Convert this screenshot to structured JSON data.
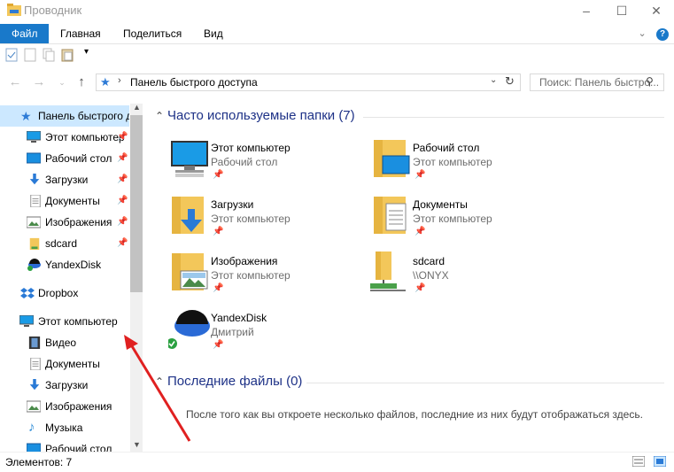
{
  "window": {
    "title": "Проводник"
  },
  "ribbon": {
    "tabs": [
      "Файл",
      "Главная",
      "Поделиться",
      "Вид"
    ]
  },
  "address": {
    "path": "Панель быстрого доступа"
  },
  "search": {
    "placeholder": "Поиск: Панель быстро..."
  },
  "sidebar": {
    "items": [
      {
        "label": "Панель быстрого д",
        "icon": "star-icon"
      },
      {
        "label": "Этот компьютер",
        "icon": "computer-icon",
        "pinned": true
      },
      {
        "label": "Рабочий стол",
        "icon": "desktop-icon",
        "pinned": true
      },
      {
        "label": "Загрузки",
        "icon": "downloads-icon",
        "pinned": true
      },
      {
        "label": "Документы",
        "icon": "documents-icon",
        "pinned": true
      },
      {
        "label": "Изображения",
        "icon": "pictures-icon",
        "pinned": true
      },
      {
        "label": "sdcard",
        "icon": "folder-icon",
        "pinned": true
      },
      {
        "label": "YandexDisk",
        "icon": "yandexdisk-icon"
      },
      {
        "label": "Dropbox",
        "icon": "dropbox-icon"
      },
      {
        "label": "Этот компьютер",
        "icon": "computer-icon"
      },
      {
        "label": "Видео",
        "icon": "video-icon"
      },
      {
        "label": "Документы",
        "icon": "documents-icon"
      },
      {
        "label": "Загрузки",
        "icon": "downloads-icon"
      },
      {
        "label": "Изображения",
        "icon": "pictures-icon"
      },
      {
        "label": "Музыка",
        "icon": "music-icon"
      },
      {
        "label": "Рабочий стол",
        "icon": "desktop-icon"
      }
    ]
  },
  "frequent": {
    "header": "Часто используемые папки (7)",
    "folders": [
      {
        "name": "Этот компьютер",
        "location": "Рабочий стол",
        "icon": "computer-icon"
      },
      {
        "name": "Рабочий стол",
        "location": "Этот компьютер",
        "icon": "desktop-folder-icon"
      },
      {
        "name": "Загрузки",
        "location": "Этот компьютер",
        "icon": "downloads-folder-icon"
      },
      {
        "name": "Документы",
        "location": "Этот компьютер",
        "icon": "documents-folder-icon"
      },
      {
        "name": "Изображения",
        "location": "Этот компьютер",
        "icon": "pictures-folder-icon"
      },
      {
        "name": "sdcard",
        "location": "\\\\ONYX",
        "icon": "network-folder-icon"
      },
      {
        "name": "YandexDisk",
        "location": "Дмитрий",
        "icon": "yandexdisk-icon"
      }
    ]
  },
  "recent": {
    "header": "Последние файлы (0)",
    "empty_message": "После того как вы откроете несколько файлов, последние из них будут отображаться здесь."
  },
  "status": {
    "items": "Элементов: 7"
  },
  "colors": {
    "accent": "#1979ca",
    "header": "#1e3287",
    "arrow": "#e02020",
    "folder": "#f3c75a"
  }
}
